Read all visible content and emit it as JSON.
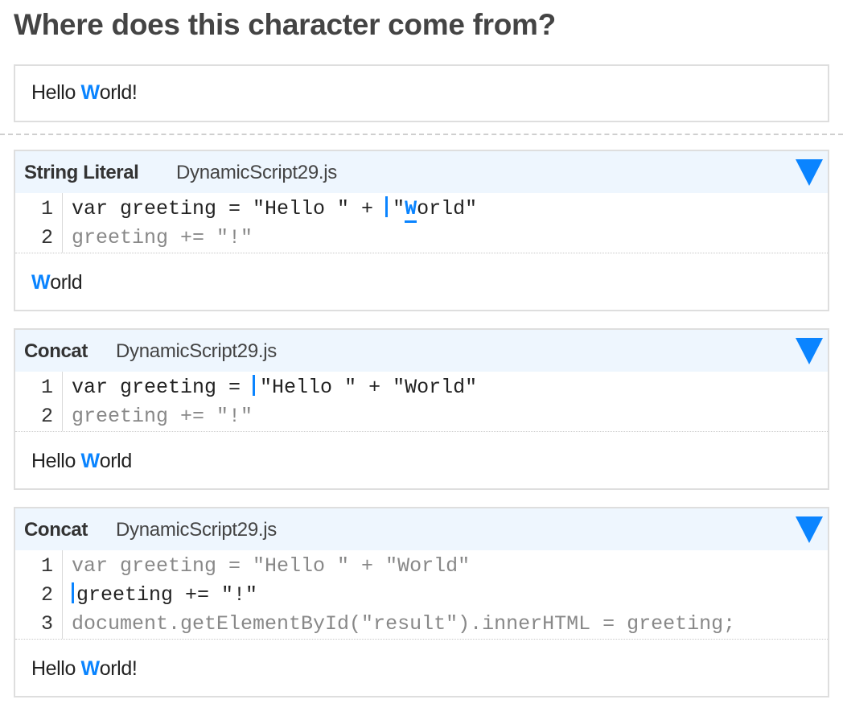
{
  "page": {
    "title": "Where does this character come from?"
  },
  "result": {
    "before": "Hello ",
    "highlight": "W",
    "after": "orld!"
  },
  "steps": [
    {
      "operation": "String Literal",
      "file": "DynamicScript29.js",
      "lines": [
        {
          "num": "1",
          "before": "var greeting = \"Hello \" + ",
          "after": "\"",
          "char": "W",
          "rest": "orld\""
        },
        {
          "num": "2",
          "text": "greeting += \"!\""
        }
      ],
      "output": {
        "before": "",
        "highlight": "W",
        "after": "orld"
      }
    },
    {
      "operation": "Concat",
      "file": "DynamicScript29.js",
      "lines": [
        {
          "num": "1",
          "before": "var greeting = ",
          "after": "\"Hello \" + \"World\""
        },
        {
          "num": "2",
          "text": "greeting += \"!\""
        }
      ],
      "output": {
        "before": "Hello ",
        "highlight": "W",
        "after": "orld"
      }
    },
    {
      "operation": "Concat",
      "file": "DynamicScript29.js",
      "lines": [
        {
          "num": "1",
          "text": "var greeting = \"Hello \" + \"World\""
        },
        {
          "num": "2",
          "after": "greeting += \"!\""
        },
        {
          "num": "3",
          "text": "document.getElementById(\"result\").innerHTML = greeting;"
        }
      ],
      "output": {
        "before": "Hello ",
        "highlight": "W",
        "after": "orld!"
      }
    }
  ],
  "colors": {
    "accent": "#0a84ff",
    "header_bg": "#eef6fe",
    "border": "#dedede"
  },
  "icons": {
    "expand": "triangle-down-icon"
  }
}
